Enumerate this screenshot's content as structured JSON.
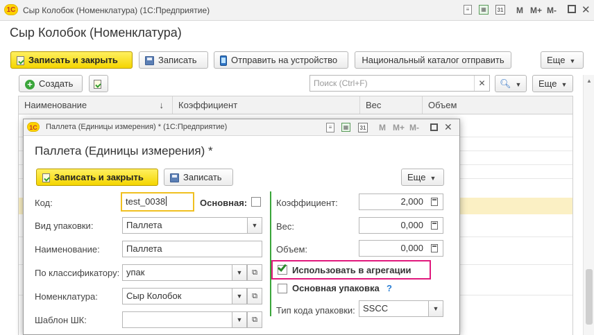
{
  "window": {
    "logo": "1С",
    "title": "Сыр Колобок (Номенклатура)  (1С:Предприятие)",
    "calendar_day": "31",
    "m": "M",
    "m_plus": "M+",
    "m_minus": "M-"
  },
  "page": {
    "title": "Сыр Колобок (Номенклатура)"
  },
  "toolbar": {
    "save_close": "Записать и закрыть",
    "save": "Записать",
    "send_device": "Отправить на устройство",
    "national_catalog": "Национальный каталог отправить",
    "more": "Еще"
  },
  "list": {
    "create": "Создать",
    "search_placeholder": "Поиск (Ctrl+F)",
    "more": "Еще",
    "columns": [
      "Наименование",
      "Коэффициент",
      "Вес",
      "Объем"
    ],
    "sort_arrow": "↓"
  },
  "modal": {
    "logo": "1С",
    "window_title": "Паллета (Единицы измерения) *  (1С:Предприятие)",
    "calendar_day": "31",
    "m": "M",
    "m_plus": "M+",
    "m_minus": "M-",
    "title": "Паллета (Единицы измерения) *",
    "save_close": "Записать и закрыть",
    "save": "Записать",
    "more": "Еще",
    "fields": {
      "code_label": "Код:",
      "code_value": "test_0038",
      "main_label": "Основная:",
      "pack_type_label": "Вид упаковки:",
      "pack_type_value": "Паллета",
      "name_label": "Наименование:",
      "name_value": "Паллета",
      "classifier_label": "По классификатору:",
      "classifier_value": "упак",
      "nomenclature_label": "Номенклатура:",
      "nomenclature_value": "Сыр Колобок",
      "barcode_template_label": "Шаблон ШК:",
      "barcode_template_value": "",
      "coef_label": "Коэффициент:",
      "coef_value": "2,000",
      "weight_label": "Вес:",
      "weight_value": "0,000",
      "volume_label": "Объем:",
      "volume_value": "0,000",
      "use_aggregation_label": "Использовать в агрегации",
      "main_pack_label": "Основная упаковка",
      "help": "?",
      "pack_code_type_label": "Тип кода упаковки:",
      "pack_code_type_value": "SSCC"
    }
  },
  "colors": {
    "primary_button": "#f4d500",
    "highlight_border": "#e0187c",
    "divider": "#3aa53a",
    "selected_row": "#fbf0c4"
  }
}
